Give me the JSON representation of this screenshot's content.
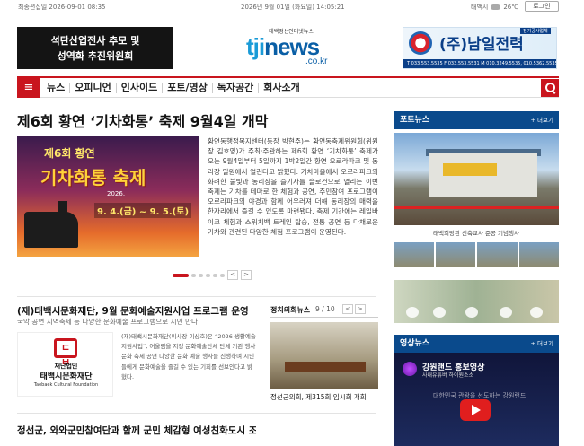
{
  "topbar": {
    "updated": "최종편집일 2026-09-01 08:35",
    "date": "2026년 9월 01일 (화요일) 14:05:21",
    "weather_label": "태백시",
    "weather_temp": "26℃",
    "login_label": "로그인"
  },
  "header": {
    "left_ad_line1": "석탄산업전사 추모 및",
    "left_ad_line2": "성역화 추진위원회",
    "logo_sub": "태백정선인터넷뉴스",
    "logo_a": "tji",
    "logo_b": "news",
    "logo_domain": ".co.kr",
    "right_ad_name": "(주)남일전력",
    "right_ad_tag": "전기공사업체",
    "right_ad_phones": "T 033.553.5535  F 033.553.5531  M 010.3249.5535, 010.5362.5535"
  },
  "nav": {
    "items": [
      "뉴스",
      "오피니언",
      "인사이드",
      "포토/영상",
      "독자공간",
      "회사소개"
    ]
  },
  "main": {
    "headline": "제6회 황연 ‘기차화통’ 축제 9월4일 개막",
    "poster_line1": "제6회 황연",
    "poster_line2": "기차화통 축제",
    "poster_year": "2026.",
    "poster_dates": "9. 4.(금) ~ 9. 5.(토)",
    "body": "황연동행정복지센터(동장 박현주)는 황연동축제위원회(위원장 김호영)가 주최·주관하는 제6회 황연 ‘기차화통’ 축제가 오는 9월4일부터 5일까지 1박2일간 황연 오로라파크 및 동리장 일원에서 열린다고 밝혔다. 기차마을에서 오로라파크의 화려한 불빛과 동리장을 즐기자를 슬로건으로 열리는 이번 축제는 기차를 테마로 한 체험과 공연, 주민참여 프로그램이 오로라파크의 야경과 함께 어우러져 더해 동리장의 매력을 한자리에서 즐길 수 있도록 마련됐다. 축제 기간에는 레일바이크 체험과 스위치백 트레인 탑승, 전통 공연 등 다채로운 기차와 관련된 다양한 체험 프로그램이 운영된다."
  },
  "pager": {
    "prev": "<",
    "next": ">"
  },
  "photo_news": {
    "title": "포토뉴스",
    "more": "+ 더보기",
    "caption": "태백희망관 신축교사 준공 기념행사"
  },
  "video": {
    "title": "영상뉴스",
    "more": "+ 더보기",
    "channel": "강원랜드 홍보영상",
    "channel_sub": "사내유튜버 하이원소소",
    "caption": "대한민국 관광을 선도하는 강원랜드"
  },
  "article2": {
    "title": "(재)태백시문화재단, 9월 문화예술지원사업 프로그램 운영",
    "summary": "국악 공연 지역축제 등 다양한 문화예술 프로그램으로 시민 만나",
    "logo_line1": "재단법인",
    "logo_line2": "태백시문화재단",
    "logo_en": "Taebaek Cultural Foundation",
    "body": "(재)태백시문화재단(이사장 이상호)은 “2026 생활예술지원사업”, 어울림을 지정 문화예술단체 단체 기관 행사 문화 축제 공연 다양한 문화 예술 행사를 진행하며 시민들에게 문화예술을 즐길 수 있는 기회를 선보인다고 밝혔다."
  },
  "politics": {
    "title": "정치의회뉴스",
    "page": "9 / 10",
    "prev": "<",
    "next": ">",
    "caption": "정선군의회, 제315회 임시회 개회"
  },
  "article3": {
    "title": "정선군, 와와군민참여단과 함께 군민 체감형 여성친화도시 조성"
  }
}
